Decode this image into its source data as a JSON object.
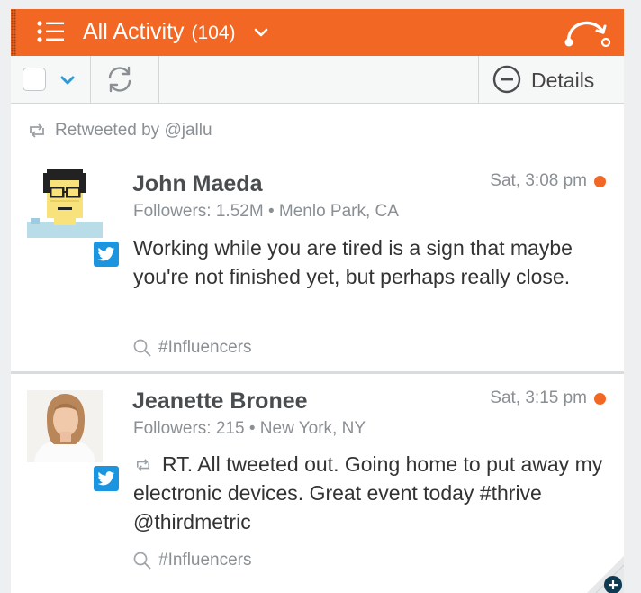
{
  "header": {
    "title": "All Activity",
    "count": "(104)",
    "accent_color": "#f26724",
    "menu_icon": "list-icon",
    "right_icon": "route-arc-icon"
  },
  "toolbar": {
    "select_all_checked": false,
    "refresh_icon": "refresh-icon",
    "details_label": "Details"
  },
  "feed": {
    "retweeted_by": "Retweeted by @jallu",
    "items": [
      {
        "name": "John Maeda",
        "followers": "Followers: 1.52M",
        "location": "Menlo Park, CA",
        "time": "Sat, 3:08 pm",
        "text": "Working while you are tired is a sign that maybe you're not finished yet, but perhaps really close.",
        "tag": "#Influencers",
        "network": "twitter"
      },
      {
        "name": "Jeanette Bronee",
        "followers": "Followers: 215",
        "location": "New York, NY",
        "time": "Sat, 3:15 pm",
        "text": "RT. All tweeted out. Going home to put away my electronic devices. Great event today #thrive @thirdmetric",
        "tag": "#Influencers",
        "network": "twitter"
      }
    ]
  }
}
